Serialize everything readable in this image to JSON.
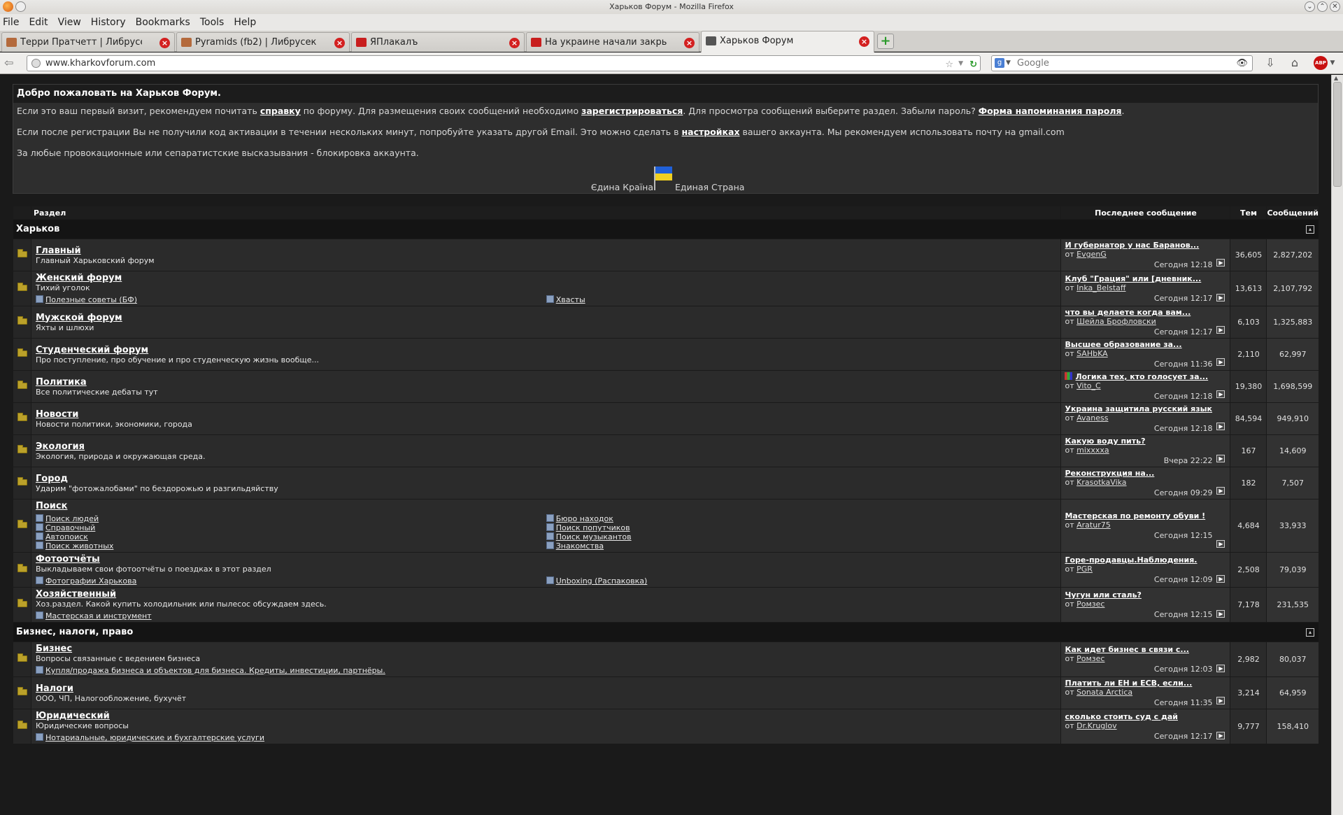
{
  "window": {
    "title": "Харьков Форум - Mozilla Firefox"
  },
  "menu": [
    "File",
    "Edit",
    "View",
    "History",
    "Bookmarks",
    "Tools",
    "Help"
  ],
  "tabs": [
    {
      "label": "Терри Пратчетт | Либрусек",
      "icon_color": "#b46a3c"
    },
    {
      "label": "Pyramids (fb2) | Либрусек",
      "icon_color": "#b46a3c"
    },
    {
      "label": "ЯПлакалъ",
      "icon_color": "#c81e1e"
    },
    {
      "label": "На украине начали закрыва...",
      "icon_color": "#c81e1e"
    },
    {
      "label": "Харьков Форум",
      "icon_color": "#555555"
    }
  ],
  "nav": {
    "url": "www.kharkovforum.com",
    "search_placeholder": "Google",
    "search_engine_letter": "g",
    "abp_label": "ABP"
  },
  "welcome": {
    "title": "Добро пожаловать на Харьков Форум.",
    "p1": {
      "t1": "Если это ваш первый визит, рекомендуем почитать ",
      "l1": "справку",
      "t2": " по форуму. Для размещения своих сообщений необходимо ",
      "l2": "зарегистрироваться",
      "t3": ". Для просмотра сообщений выберите раздел. Забыли пароль? ",
      "l3": "Форма напоминания пароля",
      "t4": "."
    },
    "p2": {
      "t1": "Если после регистрации Вы не получили код активации в течении нескольких минут, попробуйте указать другой Email. Это можно сделать в ",
      "l1": "настройках",
      "t2": " вашего аккаунта. Мы рекомендуем использовать почту на gmail.com"
    },
    "p3": "За любые провокационные или сепаратистские высказывания - блокировка аккаунта.",
    "flag_left": "Єдина Країна",
    "flag_right": "Единая Страна"
  },
  "table_headers": {
    "section": "Раздел",
    "last": "Последнее сообщение",
    "threads": "Тем",
    "posts": "Сообщений"
  },
  "categories": [
    {
      "name": "Харьков",
      "forums": [
        {
          "name": "Главный",
          "desc": "Главный Харьковский форум",
          "subs": [],
          "last_title": "И губернатор у нас Баранов...",
          "by": "от ",
          "author": "EvgenG",
          "date": "Сегодня 12:18",
          "threads": "36,605",
          "posts": "2,827,202"
        },
        {
          "name": "Женский форум",
          "desc": "Тихий уголок",
          "subs": [
            "Полезные советы (БФ)",
            "Хвасты"
          ],
          "last_title": "Клуб \"Грация\" или [дневник...",
          "by": "от ",
          "author": "Inka_Belstaff",
          "date": "Сегодня 12:17",
          "threads": "13,613",
          "posts": "2,107,792"
        },
        {
          "name": "Мужской форум",
          "desc": "Яхты и шлюхи",
          "subs": [],
          "last_title": "что вы делаете когда вам...",
          "by": "от ",
          "author": "Шейла Брофловски",
          "date": "Сегодня 12:17",
          "threads": "6,103",
          "posts": "1,325,883"
        },
        {
          "name": "Студенческий форум",
          "desc": "Про поступление, про обучение и про студенческую жизнь вообще...",
          "subs": [],
          "last_title": "Высшее образование за...",
          "by": "от ",
          "author": "SAHbKA",
          "date": "Сегодня 11:36",
          "threads": "2,110",
          "posts": "62,997"
        },
        {
          "name": "Политика",
          "desc": "Все политические дебаты тут",
          "subs": [],
          "poll": true,
          "last_title": "Логика тех, кто голосует за...",
          "by": "от ",
          "author": "Vito_C",
          "date": "Сегодня 12:18",
          "threads": "19,380",
          "posts": "1,698,599"
        },
        {
          "name": "Новости",
          "desc": "Новости политики, экономики, города",
          "subs": [],
          "last_title": "Украина защитила русский язык",
          "by": "от ",
          "author": "Avaness",
          "date": "Сегодня 12:18",
          "threads": "84,594",
          "posts": "949,910"
        },
        {
          "name": "Экология",
          "desc": "Экология, природа и окружающая среда.",
          "subs": [],
          "last_title": "Какую воду пить?",
          "by": "от ",
          "author": "mixxxxa",
          "date": "Вчера 22:22",
          "threads": "167",
          "posts": "14,609"
        },
        {
          "name": "Город",
          "desc": "Ударим \"фотожалобами\" по бездорожью и разгильдяйству",
          "subs": [],
          "last_title": "Реконструкция на...",
          "by": "от ",
          "author": "KrasotkaVika",
          "date": "Сегодня 09:29",
          "threads": "182",
          "posts": "7,507"
        },
        {
          "name": "Поиск",
          "desc": "",
          "subs": [
            "Поиск людей",
            "Бюро находок",
            "Справочный",
            "Поиск попутчиков",
            "Автопоиск",
            "Поиск музыкантов",
            "Поиск животных",
            "Знакомства"
          ],
          "last_title": "Мастерская по ремонту обуви !",
          "by": "от ",
          "author": "Aratur75",
          "date": "Сегодня 12:15",
          "threads": "4,684",
          "posts": "33,933"
        },
        {
          "name": "Фотоотчёты",
          "desc": "Выкладываем свои фотоотчёты о поездках в этот раздел",
          "subs": [
            "Фотографии Харькова",
            "Unboxing (Распаковка)"
          ],
          "last_title": "Горе-продавцы.Наблюдения.",
          "by": "от ",
          "author": "PGR",
          "date": "Сегодня 12:09",
          "threads": "2,508",
          "posts": "79,039"
        },
        {
          "name": "Хозяйственный",
          "desc": "Хоз.раздел. Какой купить холодильник или пылесос обсуждаем здесь.",
          "subs": [
            "Мастерская и инструмент"
          ],
          "last_title": "Чугун или сталь?",
          "by": "от ",
          "author": "Ромзес",
          "date": "Сегодня 12:15",
          "threads": "7,178",
          "posts": "231,535"
        }
      ]
    },
    {
      "name": "Бизнес, налоги, право",
      "forums": [
        {
          "name": "Бизнес",
          "desc": "Вопросы связанные с ведением бизнеса",
          "subs": [
            "Купля/продажа бизнеса и объектов для бизнеса. Кредиты, инвестиции, партнёры."
          ],
          "last_title": "Как идет бизнес в связи с...",
          "by": "от ",
          "author": "Ромзес",
          "date": "Сегодня 12:03",
          "threads": "2,982",
          "posts": "80,037"
        },
        {
          "name": "Налоги",
          "desc": "ООО, ЧП, Налогообложение, бухучёт",
          "subs": [],
          "last_title": "Платить ли ЕН и ЕСВ, если...",
          "by": "от ",
          "author": "Sonata Arctica",
          "date": "Сегодня 11:35",
          "threads": "3,214",
          "posts": "64,959"
        },
        {
          "name": "Юридический",
          "desc": "Юридические вопросы",
          "subs": [
            "Нотариальные, юридические и бухгалтерские услуги"
          ],
          "last_title": "сколько стоить суд с дай",
          "by": "от ",
          "author": "Dr.Kruglov",
          "date": "Сегодня 12:17",
          "threads": "9,777",
          "posts": "158,410"
        }
      ]
    }
  ]
}
